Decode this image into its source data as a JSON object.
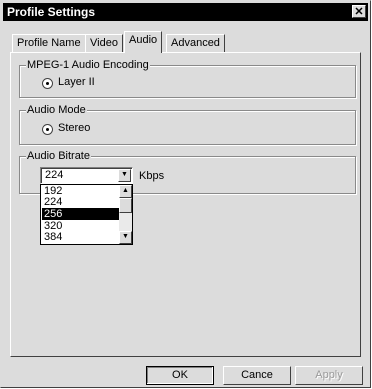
{
  "window": {
    "title": "Profile Settings",
    "close_glyph": "✕"
  },
  "tabs": [
    {
      "label": "Profile Name",
      "active": false
    },
    {
      "label": "Video",
      "active": false
    },
    {
      "label": "Audio",
      "active": true
    },
    {
      "label": "Advanced",
      "active": false
    }
  ],
  "audio_encoding": {
    "legend": "MPEG-1 Audio Encoding",
    "option": "Layer II",
    "selected": true
  },
  "audio_mode": {
    "legend": "Audio Mode",
    "option": "Stereo",
    "selected": true
  },
  "audio_bitrate": {
    "legend": "Audio Bitrate",
    "value": "224",
    "unit": "Kbps",
    "options": [
      "192",
      "224",
      "256",
      "320",
      "384"
    ],
    "highlighted": "256"
  },
  "buttons": {
    "ok": "OK",
    "cancel": "Cance",
    "apply": "Apply"
  },
  "icons": {
    "close": "close-icon",
    "dropdown": "chevron-down-icon",
    "scroll_up": "scroll-up-icon",
    "scroll_down": "scroll-down-icon"
  }
}
